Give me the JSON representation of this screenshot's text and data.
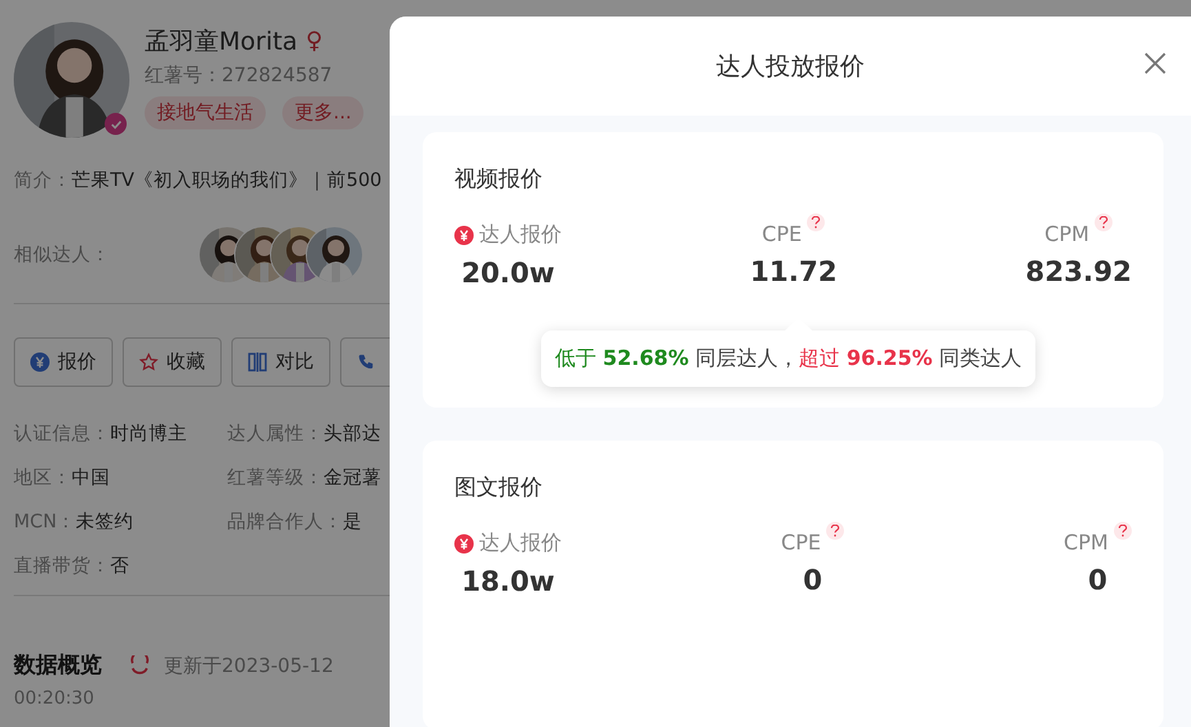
{
  "profile": {
    "name": "孟羽童Morita",
    "gender_mark": "♀",
    "verified": true,
    "red_id": "红薯号：272824587",
    "tags": [
      {
        "label": "接地气生活"
      },
      {
        "label": "更多..."
      }
    ],
    "intro_label": "简介：",
    "intro": "芒果TV《初入职场的我们》｜前500",
    "similar_label": "相似达人："
  },
  "actions": [
    {
      "kind": "quote",
      "label": "报价"
    },
    {
      "kind": "favorite",
      "label": "收藏"
    },
    {
      "kind": "compare",
      "label": "对比"
    },
    {
      "kind": "contact"
    }
  ],
  "info": [
    {
      "label": "认证信息：",
      "value": "时尚博主"
    },
    {
      "label": "达人属性：",
      "value": "头部达"
    },
    {
      "label": "地区：",
      "value": "中国"
    },
    {
      "label": "红薯等级：",
      "value": "金冠薯"
    },
    {
      "label": "MCN：",
      "value": "未签约"
    },
    {
      "label": "品牌合作人：",
      "value": "是"
    },
    {
      "label": "直播带货：",
      "value": "否"
    }
  ],
  "overview": {
    "title": "数据概览",
    "updated": "更新于2023-05-12",
    "time": "00:20:30"
  },
  "drawer": {
    "title": "达人投放报价",
    "cards": [
      {
        "title": "视频报价",
        "metrics": [
          {
            "kind": "price",
            "label": "达人报价",
            "value": "20.0w"
          },
          {
            "kind": "help",
            "label": "CPE",
            "value": "11.72"
          },
          {
            "kind": "help",
            "label": "CPM",
            "value": "823.92"
          }
        ],
        "tooltip": {
          "segments": [
            {
              "text": "低于 **52.68%**",
              "color": "#1f8a1f"
            },
            {
              "text": " 同层达人，",
              "color": "#444444"
            },
            {
              "text": "超过 **96.25%**",
              "color": "#e8334a"
            },
            {
              "text": " 同类达人",
              "color": "#444444"
            }
          ]
        }
      },
      {
        "title": "图文报价",
        "metrics": [
          {
            "kind": "price",
            "label": "达人报价",
            "value": "18.0w"
          },
          {
            "kind": "help",
            "label": "CPE",
            "value": "0"
          },
          {
            "kind": "help",
            "label": "CPM",
            "value": "0"
          }
        ]
      }
    ]
  }
}
